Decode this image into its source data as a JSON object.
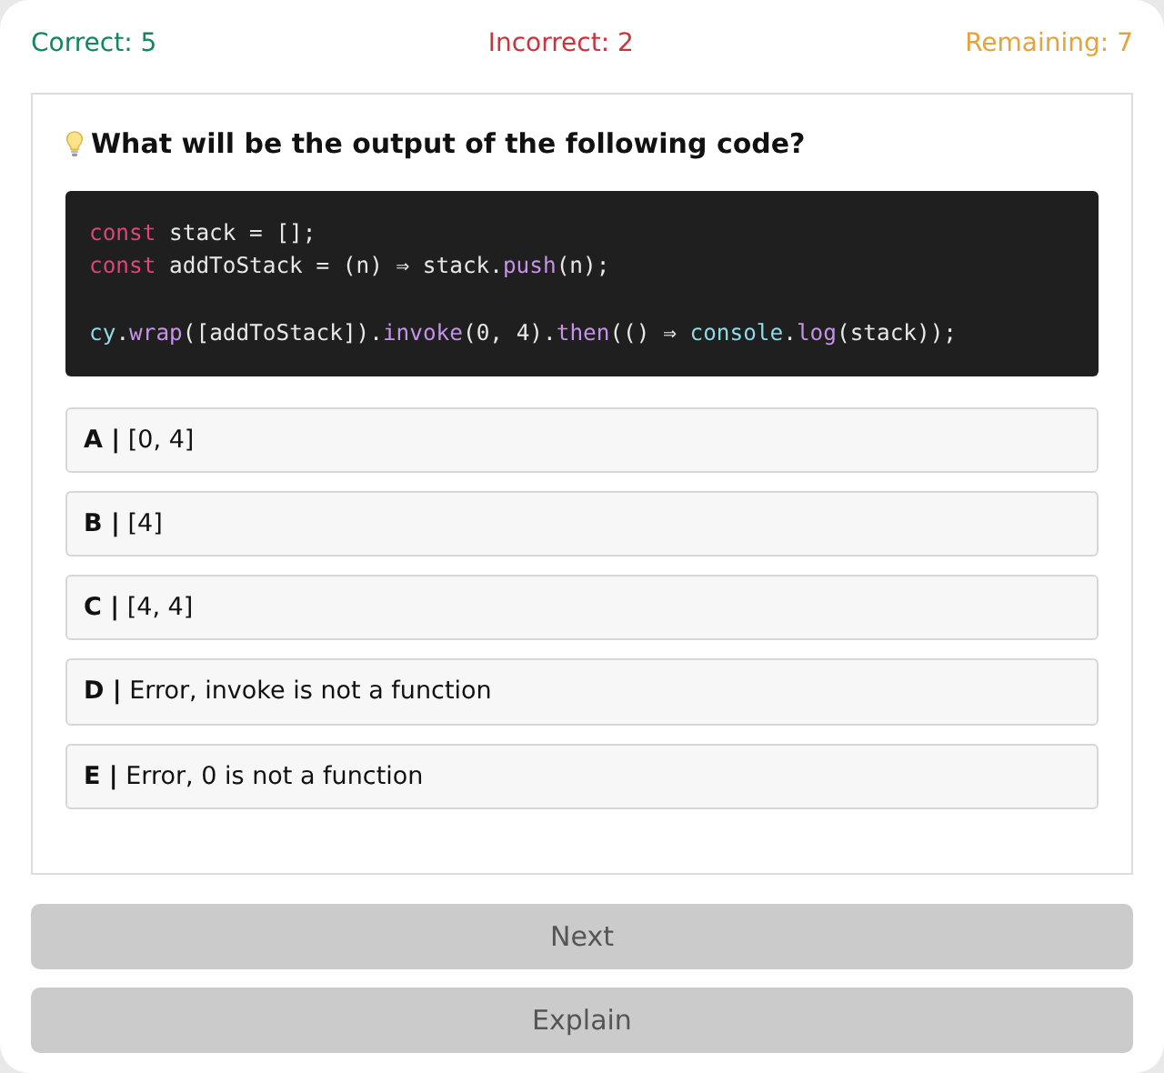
{
  "score": {
    "correct": "Correct: 5",
    "incorrect": "Incorrect: 2",
    "remaining": "Remaining: 7"
  },
  "question": {
    "title": "What will be the output of the following code?",
    "code": [
      {
        "kind": "code",
        "tokens": [
          {
            "kind": "keyword",
            "text": "const"
          },
          {
            "kind": "plain",
            "text": " stack = [];"
          }
        ]
      },
      {
        "kind": "code",
        "tokens": [
          {
            "kind": "keyword",
            "text": "const"
          },
          {
            "kind": "plain",
            "text": " addToStack = (n) ⇒ stack."
          },
          {
            "kind": "method",
            "text": "push"
          },
          {
            "kind": "plain",
            "text": "(n);"
          }
        ]
      },
      {
        "kind": "blank"
      },
      {
        "kind": "code",
        "tokens": [
          {
            "kind": "builtin",
            "text": "cy"
          },
          {
            "kind": "plain",
            "text": "."
          },
          {
            "kind": "method",
            "text": "wrap"
          },
          {
            "kind": "plain",
            "text": "([addToStack])."
          },
          {
            "kind": "method",
            "text": "invoke"
          },
          {
            "kind": "plain",
            "text": "(0, 4)."
          },
          {
            "kind": "method",
            "text": "then"
          },
          {
            "kind": "plain",
            "text": "(() ⇒ "
          },
          {
            "kind": "builtin",
            "text": "console"
          },
          {
            "kind": "plain",
            "text": "."
          },
          {
            "kind": "method",
            "text": "log"
          },
          {
            "kind": "plain",
            "text": "(stack));"
          }
        ]
      }
    ],
    "options": [
      {
        "label": "**A |** [0, 4]",
        "selected": false
      },
      {
        "label": "**B |** [4]",
        "selected": false
      },
      {
        "label": "**C |** [4, 4]",
        "selected": false
      },
      {
        "label": "**D |** Error, invoke is not a function",
        "selected": false
      },
      {
        "label": "**E |** Error, 0 is not a function",
        "selected": false
      }
    ]
  },
  "buttons": [
    {
      "label": "Next",
      "disabled": true
    },
    {
      "label": "Explain",
      "disabled": true
    }
  ]
}
